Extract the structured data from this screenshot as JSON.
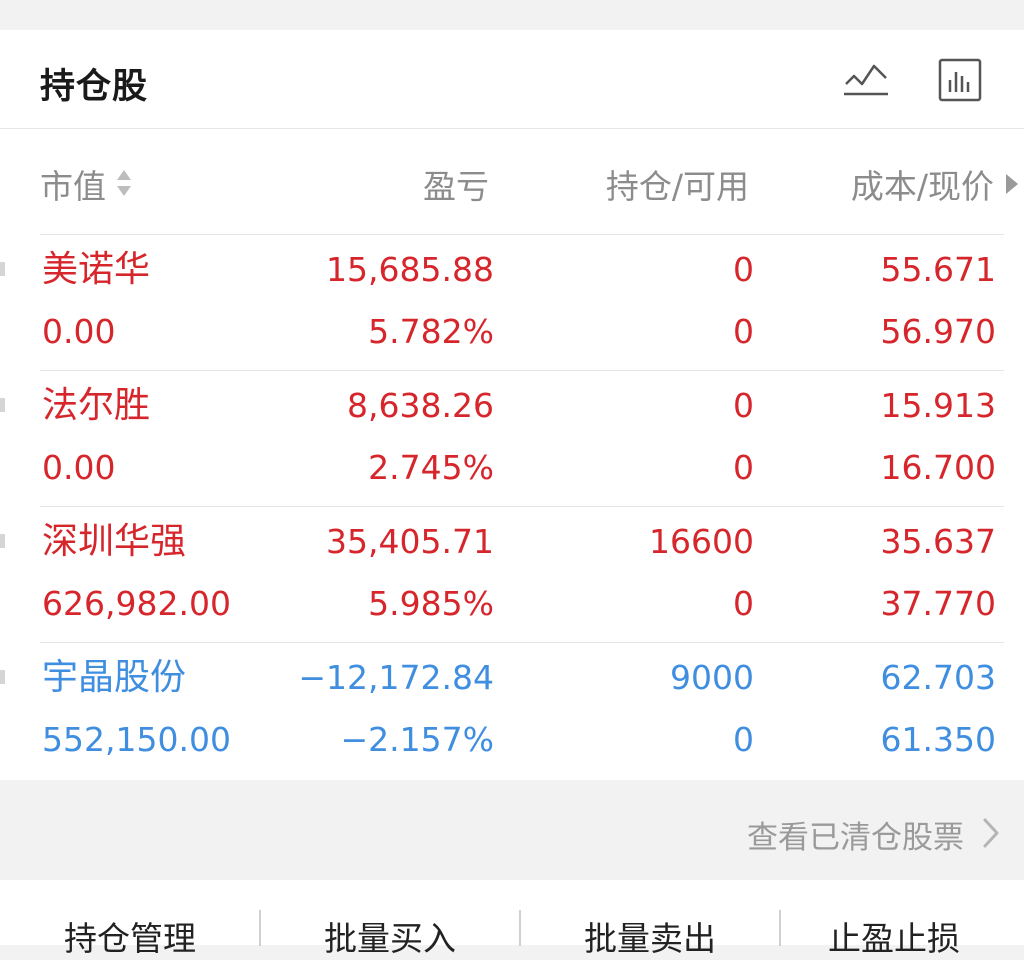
{
  "header": {
    "title": "持仓股",
    "icons": [
      "line-chart-icon",
      "bar-chart-icon"
    ]
  },
  "columns": {
    "market_value": "市值",
    "profit_loss": "盈亏",
    "position_available": "持仓/可用",
    "cost_price": "成本/现价"
  },
  "colors": {
    "up": "#d6262b",
    "down": "#3f8ee0",
    "muted": "#8c8c8c"
  },
  "holdings": [
    {
      "name": "美诺华",
      "market_value": "0.00",
      "profit_loss": "15,685.88",
      "profit_loss_ratio": "5.782%",
      "position": "0",
      "available": "0",
      "cost": "55.671",
      "price": "56.970",
      "trend": "up"
    },
    {
      "name": "法尔胜",
      "market_value": "0.00",
      "profit_loss": "8,638.26",
      "profit_loss_ratio": "2.745%",
      "position": "0",
      "available": "0",
      "cost": "15.913",
      "price": "16.700",
      "trend": "up"
    },
    {
      "name": "深圳华强",
      "market_value": "626,982.00",
      "profit_loss": "35,405.71",
      "profit_loss_ratio": "5.985%",
      "position": "16600",
      "available": "0",
      "cost": "35.637",
      "price": "37.770",
      "trend": "up"
    },
    {
      "name": "宇晶股份",
      "market_value": "552,150.00",
      "profit_loss": "−12,172.84",
      "profit_loss_ratio": "−2.157%",
      "position": "9000",
      "available": "0",
      "cost": "62.703",
      "price": "61.350",
      "trend": "down"
    }
  ],
  "cleared_link": "查看已清仓股票",
  "bottom_tabs": [
    "持仓管理",
    "批量买入",
    "批量卖出",
    "止盈止损"
  ]
}
